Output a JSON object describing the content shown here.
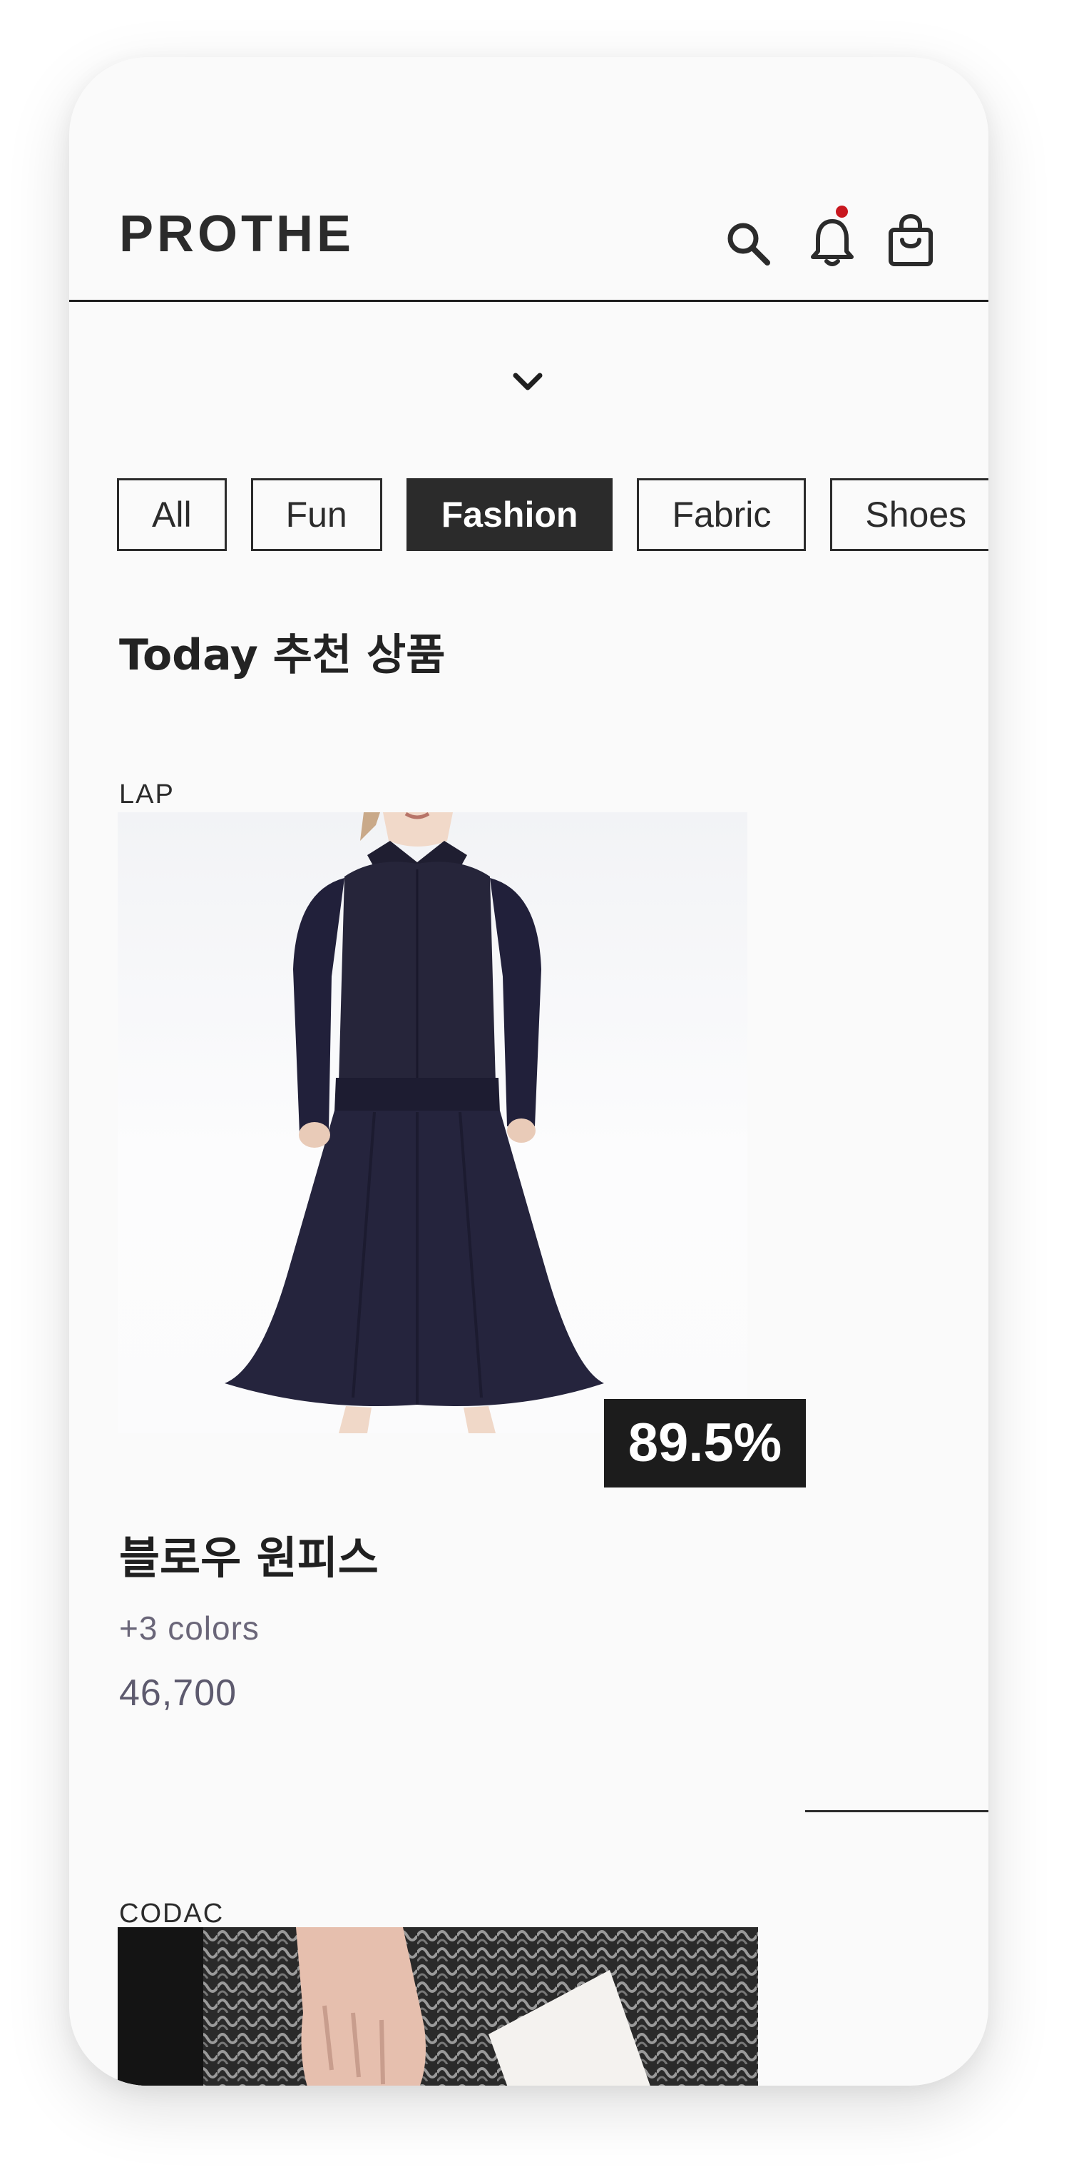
{
  "header": {
    "brand": "PROTHE",
    "icons": [
      "search-icon",
      "bell-icon",
      "shopping-bag-icon"
    ],
    "notification_dot_color": "#c8171e"
  },
  "expand_icon": "chevron-down-icon",
  "categories": [
    {
      "label": "All",
      "active": false
    },
    {
      "label": "Fun",
      "active": false
    },
    {
      "label": "Fashion",
      "active": true
    },
    {
      "label": "Fabric",
      "active": false
    },
    {
      "label": "Shoes",
      "active": false
    }
  ],
  "section": {
    "title": "Today 추천 상품"
  },
  "products": [
    {
      "brand": "LAP",
      "discount": "89.5%",
      "name": "블로우 원피스",
      "colors": "+3 colors",
      "price": "46,700"
    },
    {
      "brand": "CODAC"
    }
  ],
  "colors": {
    "background": "#fafafa",
    "text": "#2b2b2b",
    "active_chip": "#2b2b2b",
    "badge": "#1c1c1c",
    "secondary_text": "#6a6679"
  }
}
